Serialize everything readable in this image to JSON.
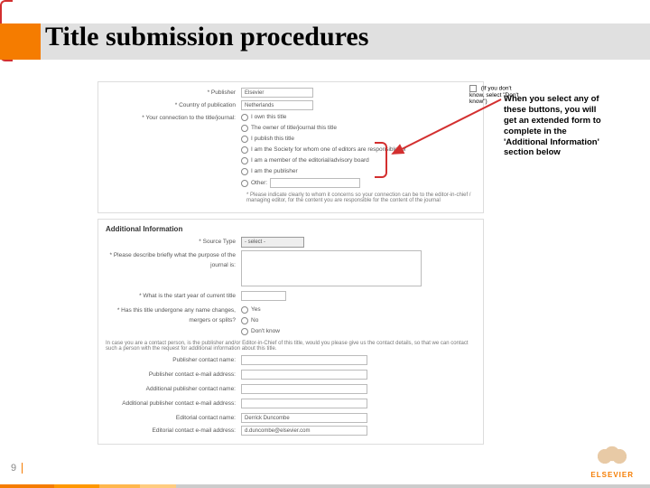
{
  "slide": {
    "title": "Title submission procedures",
    "page_number": "9"
  },
  "callout": {
    "text": "When you select any of these buttons, you will get an extended form to complete in the 'Additional Information' section below"
  },
  "top_panel": {
    "publisher_label": "* Publisher",
    "publisher_value": "Elsevier",
    "country_label": "* Country of publication",
    "country_value": "Netherlands",
    "dontknow_chk": "(If you don't know, select \"Don't know\")",
    "connection_label": "* Your connection to the title/journal:",
    "radios": {
      "r1": "I own this title",
      "r2": "The owner of title/journal this title",
      "r3": "I publish this title",
      "r4": "I am the Society for whom one of editors are responsible for",
      "r5": "I am a member of the editorial/advisory board",
      "r6": "I am the publisher",
      "r7": "Other:"
    },
    "note": "* Please indicate clearly to whom it concerns so your connection can be to the editor-in-chief / managing editor, for the content you are responsible for the content of the journal"
  },
  "additional": {
    "section_title": "Additional Information",
    "source_type_label": "* Source Type",
    "source_type_value": "- select -",
    "describe_label": "* Please describe briefly what the purpose of the journal is:",
    "start_year_label": "* What is the start year of current title",
    "name_changes_label": "* Has this title undergone any name changes, mergers or splits?",
    "rc_yes": "Yes",
    "rc_no": "No",
    "rc_dont": "Don't know",
    "contact_note": "In case you are a contact person, is the publisher and/or Editor-in-Chief of this title, would you please give us the contact details, so that we can contact such a person with the request for additional information about this title.",
    "pub_name_label": "Publisher contact name:",
    "pub_email_label": "Publisher contact e-mail address:",
    "add_pub_name_label": "Additional publisher contact name:",
    "add_pub_email_label": "Additional publisher contact e-mail address:",
    "editor_name_label": "Editorial contact name:",
    "editor_name_value": "Derrick Duncombe",
    "editor_email_label": "Editorial contact e-mail address:",
    "editor_email_value": "d.duncombe@elsevier.com"
  },
  "logo": {
    "text": "ELSEVIER"
  }
}
